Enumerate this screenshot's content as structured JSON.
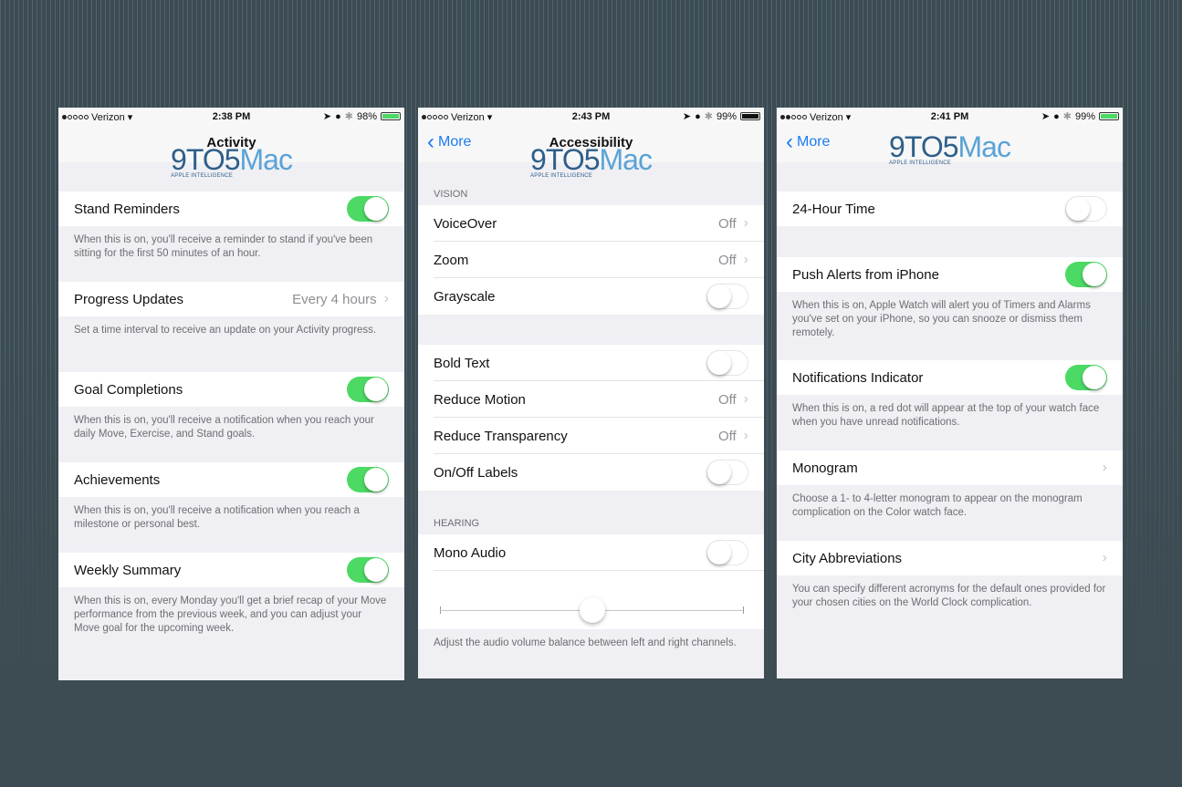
{
  "colors": {
    "accent_green": "#4cd964",
    "ios_blue": "#1c7cf4",
    "background": "#3d4b52"
  },
  "watermark": {
    "main_prefix": "9TO5",
    "main_suffix": "Mac",
    "tagline": "APPLE INTELLIGENCE"
  },
  "screens": [
    {
      "status": {
        "carrier": "Verizon",
        "signal_dots": 1,
        "time": "2:38 PM",
        "battery": "98%"
      },
      "nav": {
        "title": "Activity",
        "back": ""
      },
      "sections": [
        {
          "label": "Stand Reminders",
          "toggle": true,
          "footer": "When this is on, you'll receive a reminder to stand if you've been sitting for the first 50 minutes of an hour."
        },
        {
          "label": "Progress Updates",
          "value": "Every 4 hours",
          "chevron": true,
          "footer": "Set a time interval to receive an update on your Activity progress."
        },
        {
          "label": "Goal Completions",
          "toggle": true,
          "footer": "When this is on, you'll receive a notification when you reach your daily Move, Exercise, and Stand goals."
        },
        {
          "label": "Achievements",
          "toggle": true,
          "footer": "When this is on, you'll receive a notification when you reach a milestone or personal best."
        },
        {
          "label": "Weekly Summary",
          "toggle": true,
          "footer": "When this is on, every Monday you'll get a brief recap of your Move performance from the previous week, and you can adjust your Move goal for the upcoming week."
        }
      ]
    },
    {
      "status": {
        "carrier": "Verizon",
        "signal_dots": 1,
        "time": "2:43 PM",
        "battery": "99%"
      },
      "nav": {
        "title": "Accessibility",
        "back": "More"
      },
      "vision_header": "VISION",
      "vision": [
        {
          "label": "VoiceOver",
          "value": "Off",
          "chevron": true
        },
        {
          "label": "Zoom",
          "value": "Off",
          "chevron": true
        },
        {
          "label": "Grayscale",
          "toggle": false
        }
      ],
      "display": [
        {
          "label": "Bold Text",
          "toggle": false
        },
        {
          "label": "Reduce Motion",
          "value": "Off",
          "chevron": true
        },
        {
          "label": "Reduce Transparency",
          "value": "Off",
          "chevron": true
        },
        {
          "label": "On/Off Labels",
          "toggle": false
        }
      ],
      "hearing_header": "HEARING",
      "hearing": [
        {
          "label": "Mono Audio",
          "toggle": false
        }
      ],
      "balance": {
        "value_fraction": 0.5,
        "footer": "Adjust the audio volume balance between left and right channels."
      }
    },
    {
      "status": {
        "carrier": "Verizon",
        "signal_dots": 2,
        "time": "2:41 PM",
        "battery": "99%"
      },
      "nav": {
        "title": "",
        "back": "More"
      },
      "rows": [
        {
          "label": "24-Hour Time",
          "toggle": false,
          "footer": ""
        },
        {
          "label": "Push Alerts from iPhone",
          "toggle": true,
          "footer": "When this is on, Apple Watch will alert you of Timers and Alarms you've set on your iPhone, so you can snooze or dismiss them remotely."
        },
        {
          "label": "Notifications Indicator",
          "toggle": true,
          "footer": "When this is on, a red dot will appear at the top of your watch face when you have unread notifications."
        },
        {
          "label": "Monogram",
          "chevron": true,
          "footer": "Choose a 1- to 4-letter monogram to appear on the monogram complication on the Color watch face."
        },
        {
          "label": "City Abbreviations",
          "chevron": true,
          "footer": "You can specify different acronyms for the default ones provided for your chosen cities on the World Clock complication."
        }
      ]
    }
  ]
}
